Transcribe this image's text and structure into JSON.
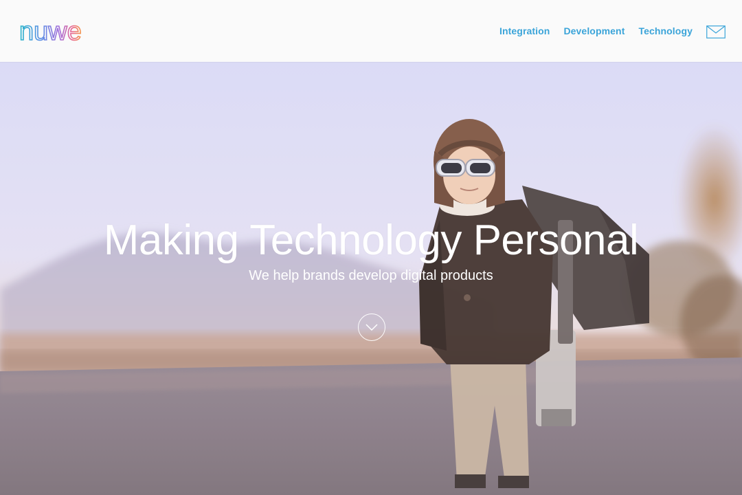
{
  "brand": {
    "logo_text": "nuwe",
    "logo_gradient": [
      "#26b5c9",
      "#5b8ee6",
      "#a56cd9",
      "#e9688f",
      "#f39a4b"
    ]
  },
  "nav": {
    "items": [
      {
        "label": "Integration"
      },
      {
        "label": "Development"
      },
      {
        "label": "Technology"
      }
    ],
    "contact_icon": "mail-icon",
    "link_color": "#3aa4d9"
  },
  "hero": {
    "title": "Making Technology Personal",
    "subtitle": "We help brands develop digital products",
    "scroll_icon": "chevron-down-circle-icon",
    "image_description_icon": "hero-photo"
  }
}
